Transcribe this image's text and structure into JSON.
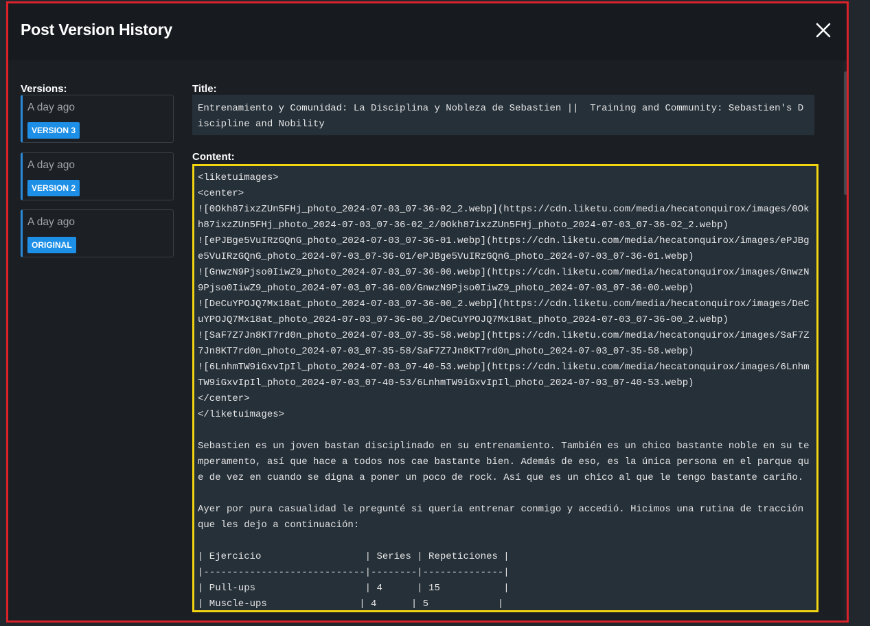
{
  "modal": {
    "title": "Post Version History",
    "close_icon": "close-icon"
  },
  "versions": {
    "heading": "Versions:",
    "items": [
      {
        "time": "A day ago",
        "badge": "VERSION 3"
      },
      {
        "time": "A day ago",
        "badge": "VERSION 2"
      },
      {
        "time": "A day ago",
        "badge": "ORIGINAL"
      }
    ]
  },
  "post": {
    "title_label": "Title:",
    "title": "Entrenamiento y Comunidad: La Disciplina y Nobleza de Sebastien ||  Training and Community: Sebastien's Discipline and Nobility",
    "content_label": "Content:",
    "content": "<liketuimages>\n<center>\n![0Okh87ixzZUn5FHj_photo_2024-07-03_07-36-02_2.webp](https://cdn.liketu.com/media/hecatonquirox/images/0Okh87ixzZUn5FHj_photo_2024-07-03_07-36-02_2/0Okh87ixzZUn5FHj_photo_2024-07-03_07-36-02_2.webp)\n![ePJBge5VuIRzGQnG_photo_2024-07-03_07-36-01.webp](https://cdn.liketu.com/media/hecatonquirox/images/ePJBge5VuIRzGQnG_photo_2024-07-03_07-36-01/ePJBge5VuIRzGQnG_photo_2024-07-03_07-36-01.webp)\n![GnwzN9Pjso0IiwZ9_photo_2024-07-03_07-36-00.webp](https://cdn.liketu.com/media/hecatonquirox/images/GnwzN9Pjso0IiwZ9_photo_2024-07-03_07-36-00/GnwzN9Pjso0IiwZ9_photo_2024-07-03_07-36-00.webp)\n![DeCuYPOJQ7Mx18at_photo_2024-07-03_07-36-00_2.webp](https://cdn.liketu.com/media/hecatonquirox/images/DeCuYPOJQ7Mx18at_photo_2024-07-03_07-36-00_2/DeCuYPOJQ7Mx18at_photo_2024-07-03_07-36-00_2.webp)\n![SaF7Z7Jn8KT7rd0n_photo_2024-07-03_07-35-58.webp](https://cdn.liketu.com/media/hecatonquirox/images/SaF7Z7Jn8KT7rd0n_photo_2024-07-03_07-35-58/SaF7Z7Jn8KT7rd0n_photo_2024-07-03_07-35-58.webp)\n![6LnhmTW9iGxvIpIl_photo_2024-07-03_07-40-53.webp](https://cdn.liketu.com/media/hecatonquirox/images/6LnhmTW9iGxvIpIl_photo_2024-07-03_07-40-53/6LnhmTW9iGxvIpIl_photo_2024-07-03_07-40-53.webp)\n</center>\n</liketuimages>\n\nSebastien es un joven bastan disciplinado en su entrenamiento. También es un chico bastante noble en su temperamento, así que hace a todos nos cae bastante bien. Además de eso, es la única persona en el parque que de vez en cuando se digna a poner un poco de rock. Así que es un chico al que le tengo bastante cariño.\n\nAyer por pura casualidad le pregunté si quería entrenar conmigo y accedió. Hicimos una rutina de tracción que les dejo a continuación:\n\n| Ejercicio                  | Series | Repeticiones |\n|----------------------------|--------|--------------|\n| Pull-ups                   | 4      | 15           |\n| Muscle-ups                | 4      | 5            |"
  },
  "colors": {
    "accent": "#1d8fe6",
    "highlight_border": "#f2d411",
    "annotation_border": "#d9222a"
  }
}
